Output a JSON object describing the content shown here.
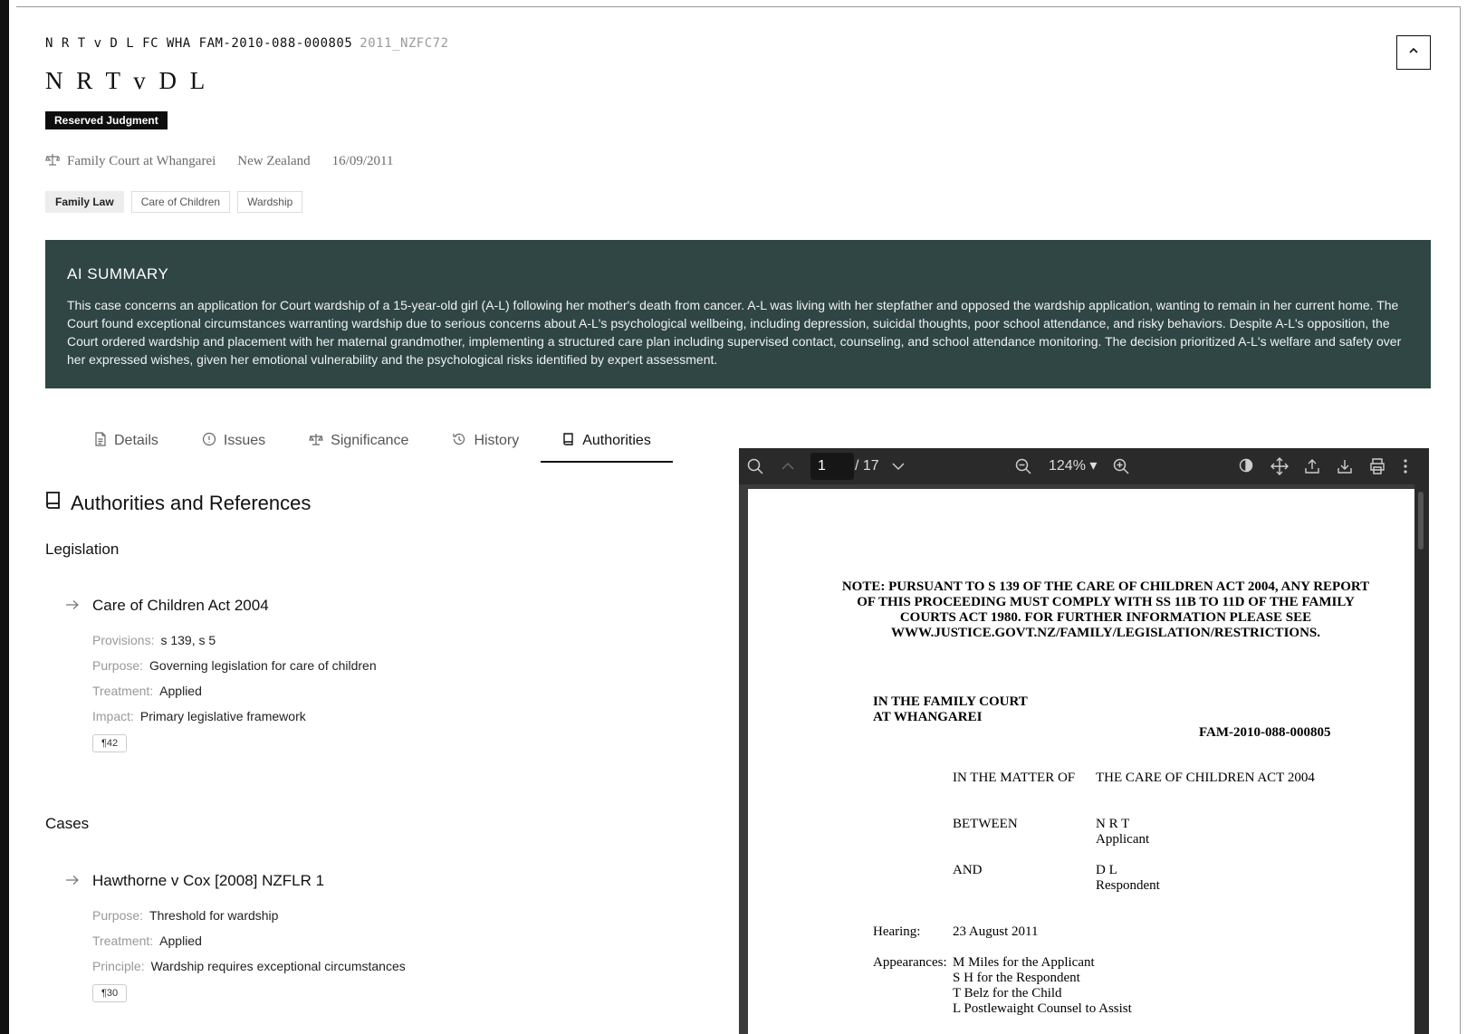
{
  "case": {
    "id_line": "N R T v D L FC WHA FAM-2010-088-000805",
    "citation": "2011_NZFC72",
    "title": "N R T v D L",
    "judgment_type": "Reserved Judgment",
    "court": "Family Court at Whangarei",
    "country": "New Zealand",
    "date": "16/09/2011",
    "tags": [
      "Family Law",
      "Care of Children",
      "Wardship"
    ]
  },
  "ai_summary": {
    "heading": "AI SUMMARY",
    "text": "This case concerns an application for Court wardship of a 15-year-old girl (A-L) following her mother's death from cancer. A-L was living with her stepfather and opposed the wardship application, wanting to remain in her current home. The Court found exceptional circumstances warranting wardship due to serious concerns about A-L's psychological wellbeing, including depression, suicidal thoughts, poor school attendance, and risky behaviors. Despite A-L's opposition, the Court ordered wardship and placement with her maternal grandmother, implementing a structured care plan including supervised contact, counseling, and school attendance monitoring. The decision prioritized A-L's welfare and safety over her expressed wishes, given her emotional vulnerability and the psychological risks identified by expert assessment."
  },
  "tabs": [
    {
      "label": "Details",
      "icon": "document-icon"
    },
    {
      "label": "Issues",
      "icon": "info-circle-icon"
    },
    {
      "label": "Significance",
      "icon": "scales-icon"
    },
    {
      "label": "History",
      "icon": "history-icon"
    },
    {
      "label": "Authorities",
      "icon": "book-icon",
      "active": true
    }
  ],
  "authorities": {
    "title": "Authorities and References",
    "legislation": {
      "heading": "Legislation",
      "items": [
        {
          "name": "Care of Children Act 2004",
          "provisions_label": "Provisions:",
          "provisions": "s 139, s 5",
          "purpose_label": "Purpose:",
          "purpose": "Governing legislation for care of children",
          "treatment_label": "Treatment:",
          "treatment": "Applied",
          "impact_label": "Impact:",
          "impact": "Primary legislative framework",
          "para": "¶42"
        }
      ]
    },
    "cases": {
      "heading": "Cases",
      "items": [
        {
          "name": "Hawthorne v Cox [2008] NZFLR 1",
          "purpose_label": "Purpose:",
          "purpose": "Threshold for wardship",
          "treatment_label": "Treatment:",
          "treatment": "Applied",
          "principle_label": "Principle:",
          "principle": "Wardship requires exceptional circumstances",
          "para": "¶30"
        }
      ]
    }
  },
  "pdf_viewer": {
    "current_page": "1",
    "total_pages": "/ 17",
    "zoom": "124% ▾",
    "document": {
      "notice": "NOTE: PURSUANT TO S 139 OF THE CARE OF CHILDREN ACT 2004, ANY REPORT OF THIS PROCEEDING MUST COMPLY WITH SS 11B TO 11D OF THE FAMILY COURTS ACT 1980.  FOR FURTHER INFORMATION PLEASE SEE WWW.JUSTICE.GOVT.NZ/FAMILY/LEGISLATION/RESTRICTIONS.",
      "court_line1": "IN THE FAMILY COURT",
      "court_line2": "AT WHANGAREI",
      "file_no": "FAM-2010-088-000805",
      "matter_label": "IN THE MATTER OF",
      "matter": "THE CARE OF CHILDREN ACT 2004",
      "between_label": "BETWEEN",
      "applicant_name": "N R T",
      "applicant_role": "Applicant",
      "and_label": "AND",
      "respondent_name": "D L",
      "respondent_role": "Respondent",
      "hearing_label": "Hearing:",
      "hearing_date": "23 August 2011",
      "appearances_label": "Appearances:",
      "appearances": [
        "M Miles for the Applicant",
        "S H for the Respondent",
        "T Belz for the Child",
        "L Postlewaight Counsel to Assist"
      ]
    }
  }
}
